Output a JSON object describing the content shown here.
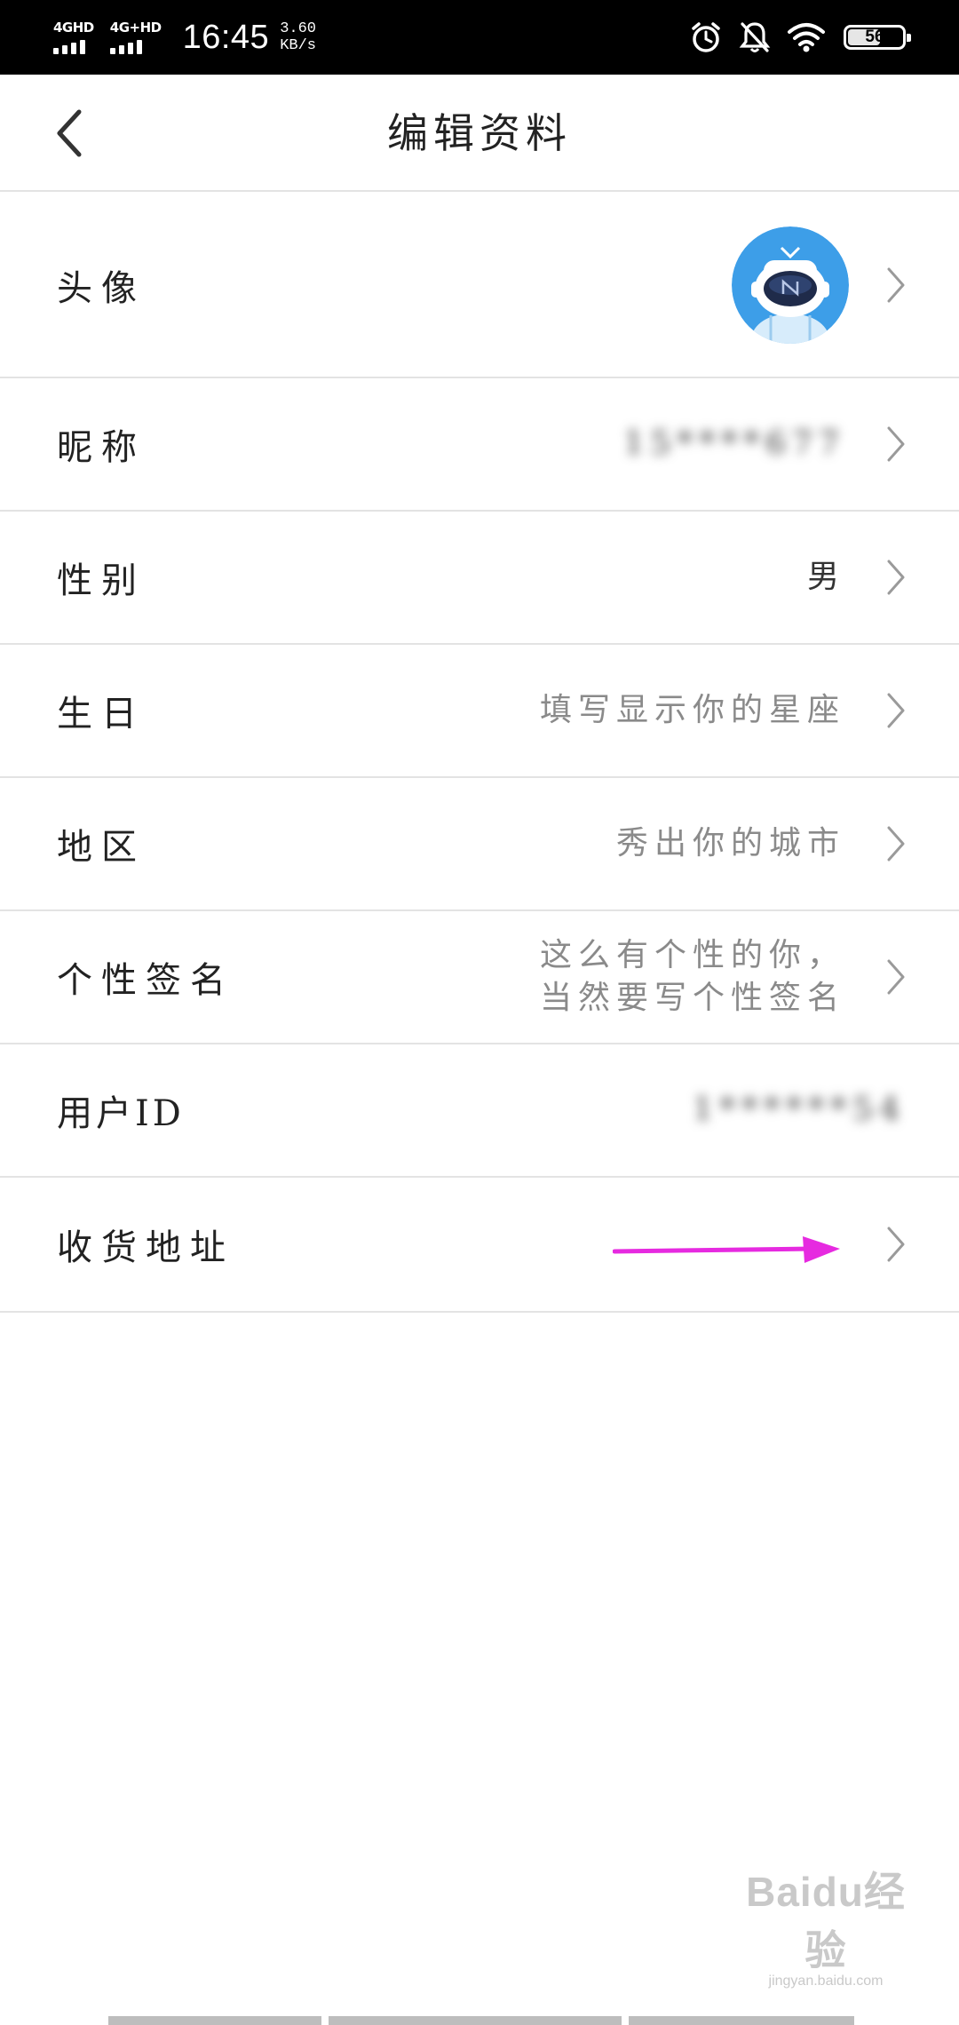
{
  "status_bar": {
    "signal_1_label": "4GHD",
    "signal_2_label": "4G+HD",
    "time": "16:45",
    "speed_value": "3.60",
    "speed_unit": "KB/s",
    "battery_level": "56",
    "icons": [
      "alarm-icon",
      "bell-muted-icon",
      "wifi-icon",
      "battery-icon"
    ]
  },
  "header": {
    "title": "编辑资料",
    "back_icon": "back-chevron-icon"
  },
  "rows": {
    "avatar": {
      "label": "头像"
    },
    "nickname": {
      "label": "昵称",
      "value": "15****677"
    },
    "gender": {
      "label": "性别",
      "value": "男"
    },
    "birthday": {
      "label": "生日",
      "value": "填写显示你的星座"
    },
    "region": {
      "label": "地区",
      "value": "秀出你的城市"
    },
    "signature": {
      "label": "个性签名",
      "value_line1": "这么有个性的你，",
      "value_line2": "当然要写个性签名"
    },
    "user_id": {
      "label": "用户ID",
      "value": "1******54"
    },
    "address": {
      "label": "收货地址"
    }
  },
  "annotation": {
    "arrow_color": "#e62ae0"
  },
  "watermark": {
    "logo": "Baidu经验",
    "sub": "jingyan.baidu.com"
  },
  "colors": {
    "divider": "#e3e3e3",
    "value_gray": "#8a8a8a",
    "text_dark": "#222222"
  }
}
